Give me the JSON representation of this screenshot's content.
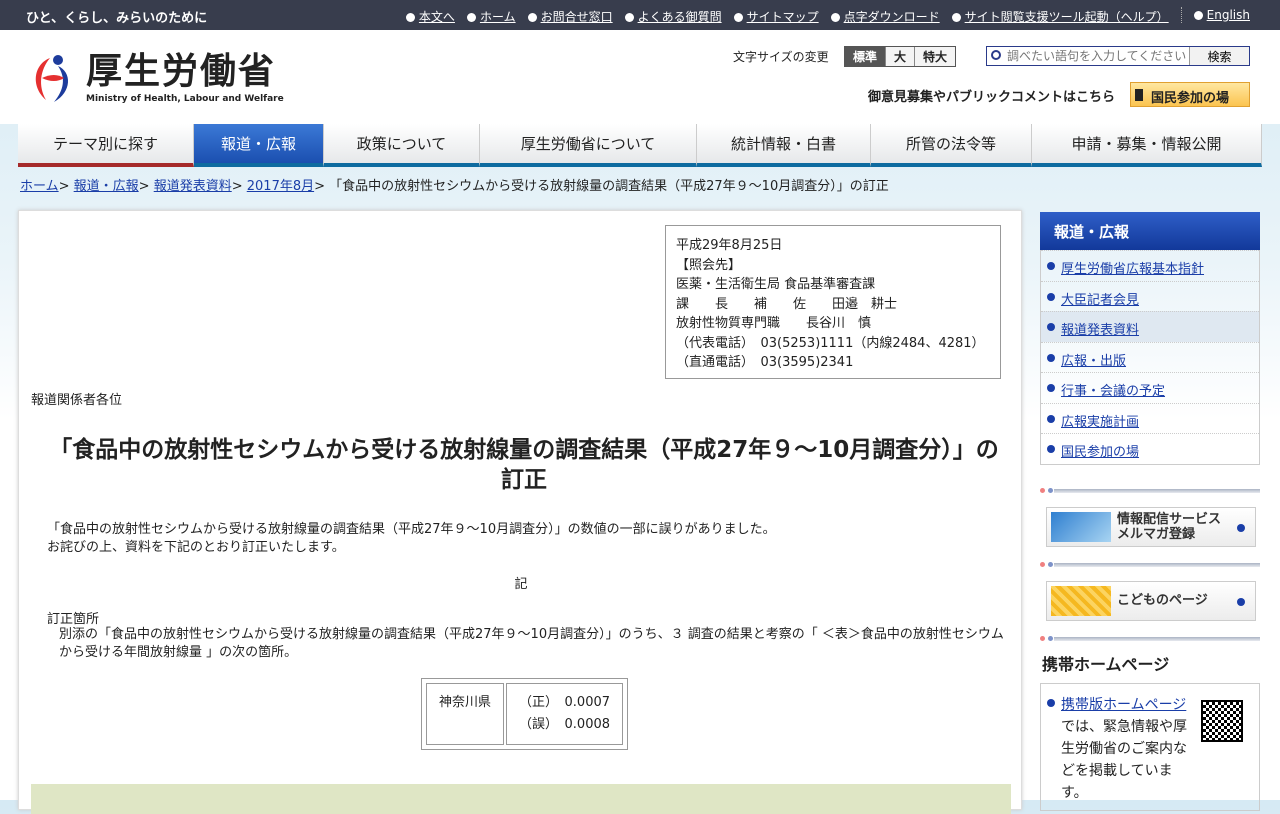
{
  "topbar": {
    "tagline": "ひと、くらし、みらいのために",
    "links": [
      "本文へ",
      "ホーム",
      "お問合せ窓口",
      "よくある御質問",
      "サイトマップ",
      "点字ダウンロード",
      "サイト閲覧支援ツール起動（ヘルプ）",
      "English"
    ]
  },
  "header": {
    "logo_jp": "厚生労働省",
    "logo_en": "Ministry of Health, Labour and Welfare",
    "font_size_label": "文字サイズの変更",
    "font_sizes": [
      "標準",
      "大",
      "特大"
    ],
    "search_placeholder": "調べたい語句を入力してください",
    "search_button": "検索",
    "public_label": "御意見募集やパブリックコメントはこちら",
    "public_button": "国民参加の場"
  },
  "nav": [
    "テーマ別に探す",
    "報道・広報",
    "政策について",
    "厚生労働省について",
    "統計情報・白書",
    "所管の法令等",
    "申請・募集・情報公開"
  ],
  "breadcrumb": {
    "links": [
      "ホーム",
      "報道・広報",
      "報道発表資料",
      "2017年8月"
    ],
    "current": "「食品中の放射性セシウムから受ける放射線量の調査結果（平成27年９～10月調査分）」の訂正"
  },
  "contact": [
    "平成29年8月25日",
    "【照会先】",
    "医薬・生活衛生局 食品基準審査課",
    "課　　長　　補　　佐　　田邉　耕士",
    "放射性物質専門職　　長谷川　慎",
    "（代表電話）　03(5253)1111（内線2484、4281）",
    "（直通電話）　03(3595)2341"
  ],
  "recipient": "報道関係者各位",
  "title": "「食品中の放射性セシウムから受ける放射線量の調査結果（平成27年９～10月調査分）」の訂正",
  "intro": [
    "「食品中の放射性セシウムから受ける放射線量の調査結果（平成27年９～10月調査分）」の数値の一部に誤りがありました。",
    "お詫びの上、資料を下記のとおり訂正いたします。"
  ],
  "ki": "記",
  "fix_label": "訂正箇所",
  "fix_body": "別添の「食品中の放射性セシウムから受ける放射線量の調査結果（平成27年９～10月調査分）」のうち、３ 調査の結果と考察の「 ＜表＞食品中の放射性セシウムから受ける年間放射線量 」の次の箇所。",
  "table": {
    "prefecture": "神奈川県",
    "correct": "（正）　0.0007",
    "wrong": "（誤）　0.0008"
  },
  "sidebar": {
    "heading": "報道・広報",
    "items": [
      "厚生労働省広報基本指針",
      "大臣記者会見",
      "報道発表資料",
      "広報・出版",
      "行事・会議の予定",
      "広報実施計画",
      "国民参加の場"
    ],
    "mail_banner": [
      "情報配信サービス",
      "メルマガ登録"
    ],
    "kids_banner": "こどものページ",
    "mobile_title": "携帯ホームページ",
    "mobile_link": "携帯版ホームページ",
    "mobile_text": "では、緊急情報や厚生労働省のご案内などを掲載しています。"
  }
}
